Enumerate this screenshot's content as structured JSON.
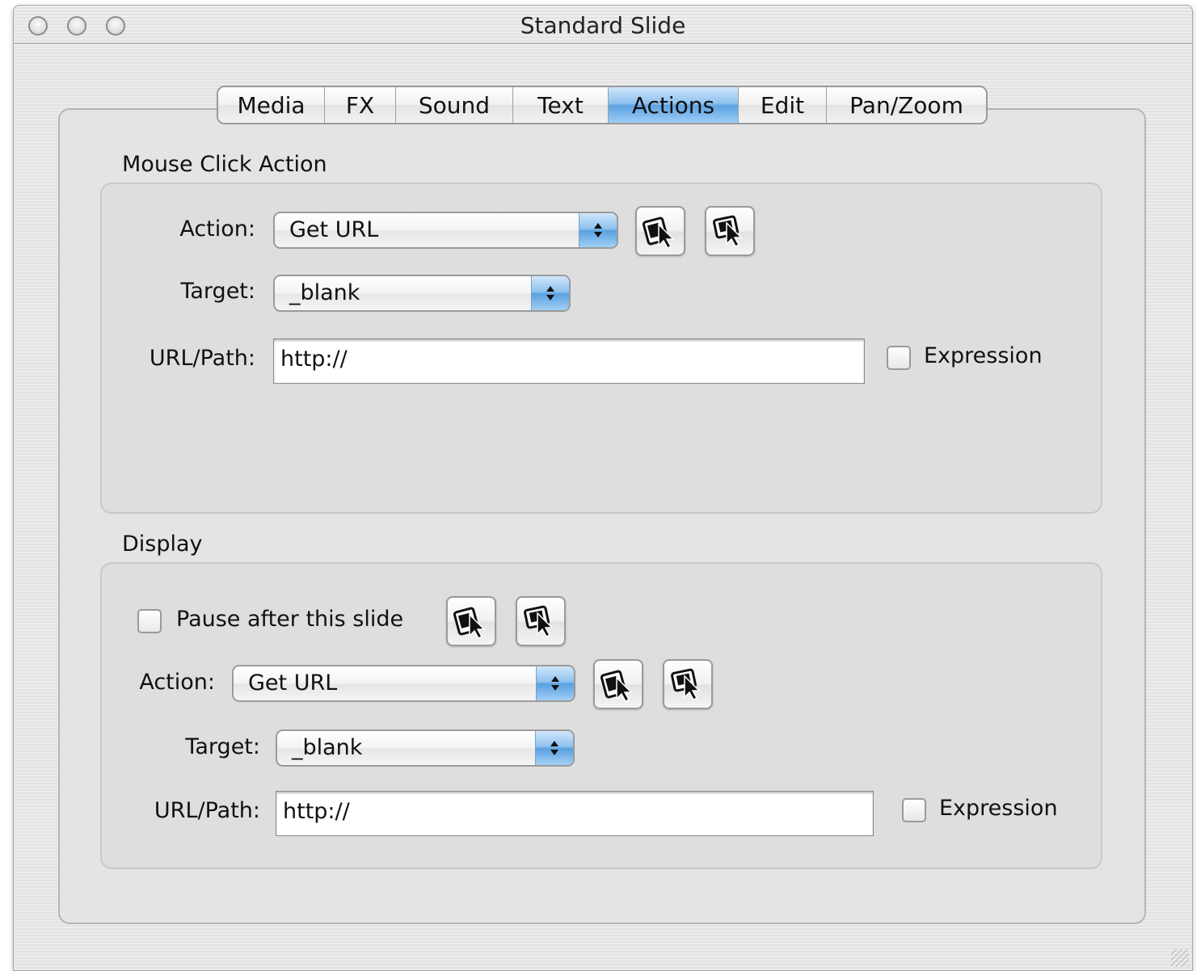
{
  "window": {
    "title": "Standard Slide"
  },
  "tabs": [
    {
      "label": "Media",
      "active": false
    },
    {
      "label": "FX",
      "active": false
    },
    {
      "label": "Sound",
      "active": false
    },
    {
      "label": "Text",
      "active": false
    },
    {
      "label": "Actions",
      "active": true
    },
    {
      "label": "Edit",
      "active": false
    },
    {
      "label": "Pan/Zoom",
      "active": false
    }
  ],
  "mouse_click_action": {
    "section_label": "Mouse Click Action",
    "action_label": "Action:",
    "action_value": "Get URL",
    "target_label": "Target:",
    "target_value": "_blank",
    "url_label": "URL/Path:",
    "url_value": "http://",
    "expression_label": "Expression"
  },
  "display": {
    "section_label": "Display",
    "pause_label": "Pause after this slide",
    "action_label": "Action:",
    "action_value": "Get URL",
    "target_label": "Target:",
    "target_value": "_blank",
    "url_label": "URL/Path:",
    "url_value": "http://",
    "expression_label": "Expression"
  },
  "icons": {
    "pick_action": "select-from-slide-icon",
    "show_action": "choose-target-icon"
  },
  "colors": {
    "accent": "#5da3e2",
    "frame": "#e4e4e4"
  }
}
